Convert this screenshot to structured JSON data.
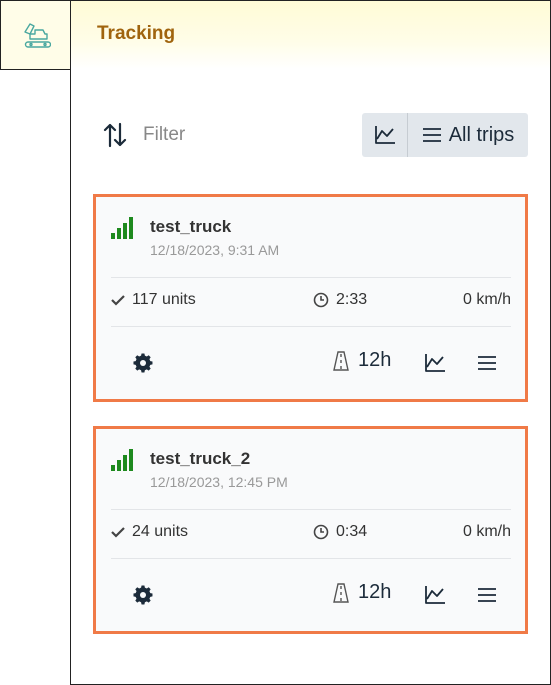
{
  "app": {
    "title": "Tracking",
    "logo_icon": "excavator-icon"
  },
  "toolbar": {
    "filter_label": "Filter",
    "all_trips_label": "All trips"
  },
  "colors": {
    "accent": "#f07a47",
    "title": "#a0640e",
    "signal": "#1e8a1e",
    "icon": "#1c2b3a"
  },
  "trucks": [
    {
      "name": "test_truck",
      "datetime": "12/18/2023, 9:31 AM",
      "units": "117 units",
      "duration": "2:33",
      "speed": "0 km/h",
      "window": "12h"
    },
    {
      "name": "test_truck_2",
      "datetime": "12/18/2023, 12:45 PM",
      "units": "24 units",
      "duration": "0:34",
      "speed": "0 km/h",
      "window": "12h"
    }
  ]
}
